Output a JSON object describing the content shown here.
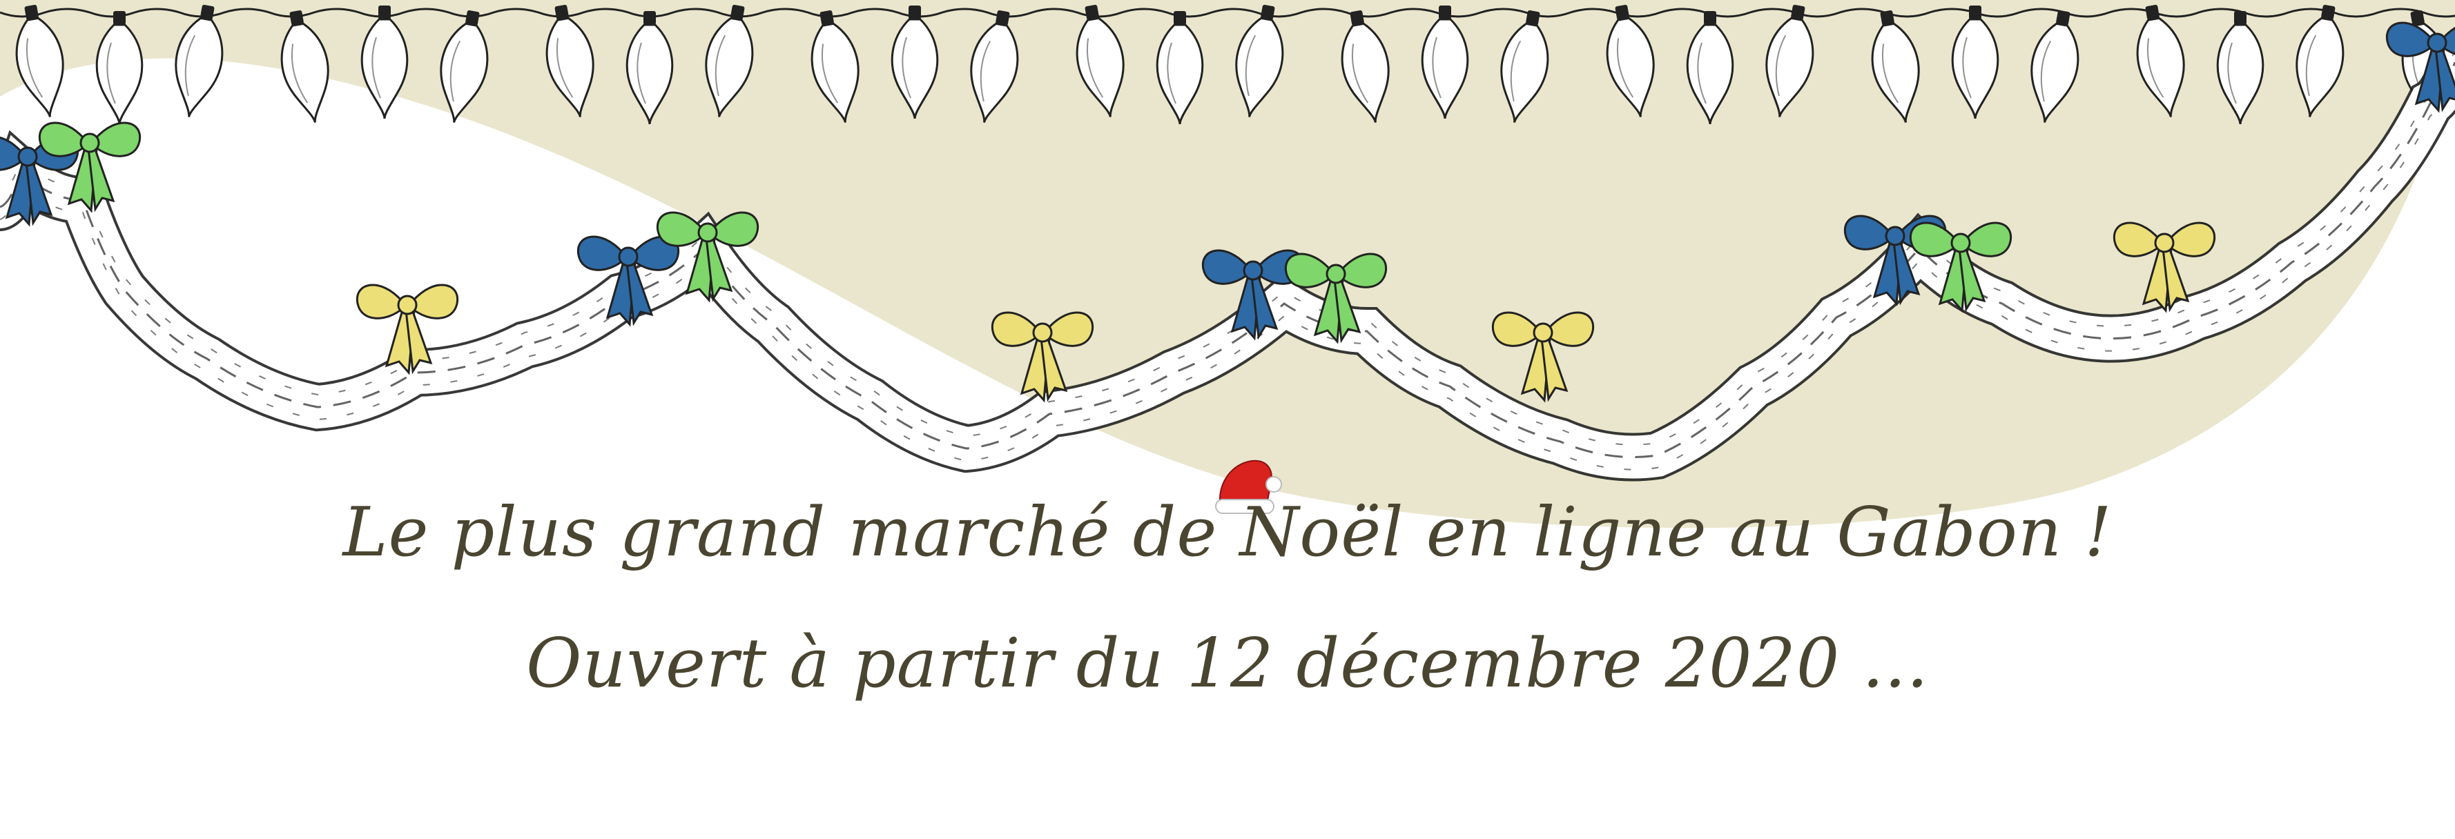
{
  "banner": {
    "line1": "Le plus grand marché de Noël en ligne au Gabon !",
    "line2": "Ouvert à partir du 12 décembre 2020 ..."
  },
  "decorations": {
    "background_swoosh_color": "#e9e6cd",
    "bow_colors": [
      "#2e6aa6",
      "#7fd66a",
      "#ecdf78"
    ],
    "garland_color": "#ffffff",
    "ink_color": "#222222",
    "icons": [
      "light-bulb-icon",
      "bow-icon",
      "santa-hat-icon"
    ]
  }
}
